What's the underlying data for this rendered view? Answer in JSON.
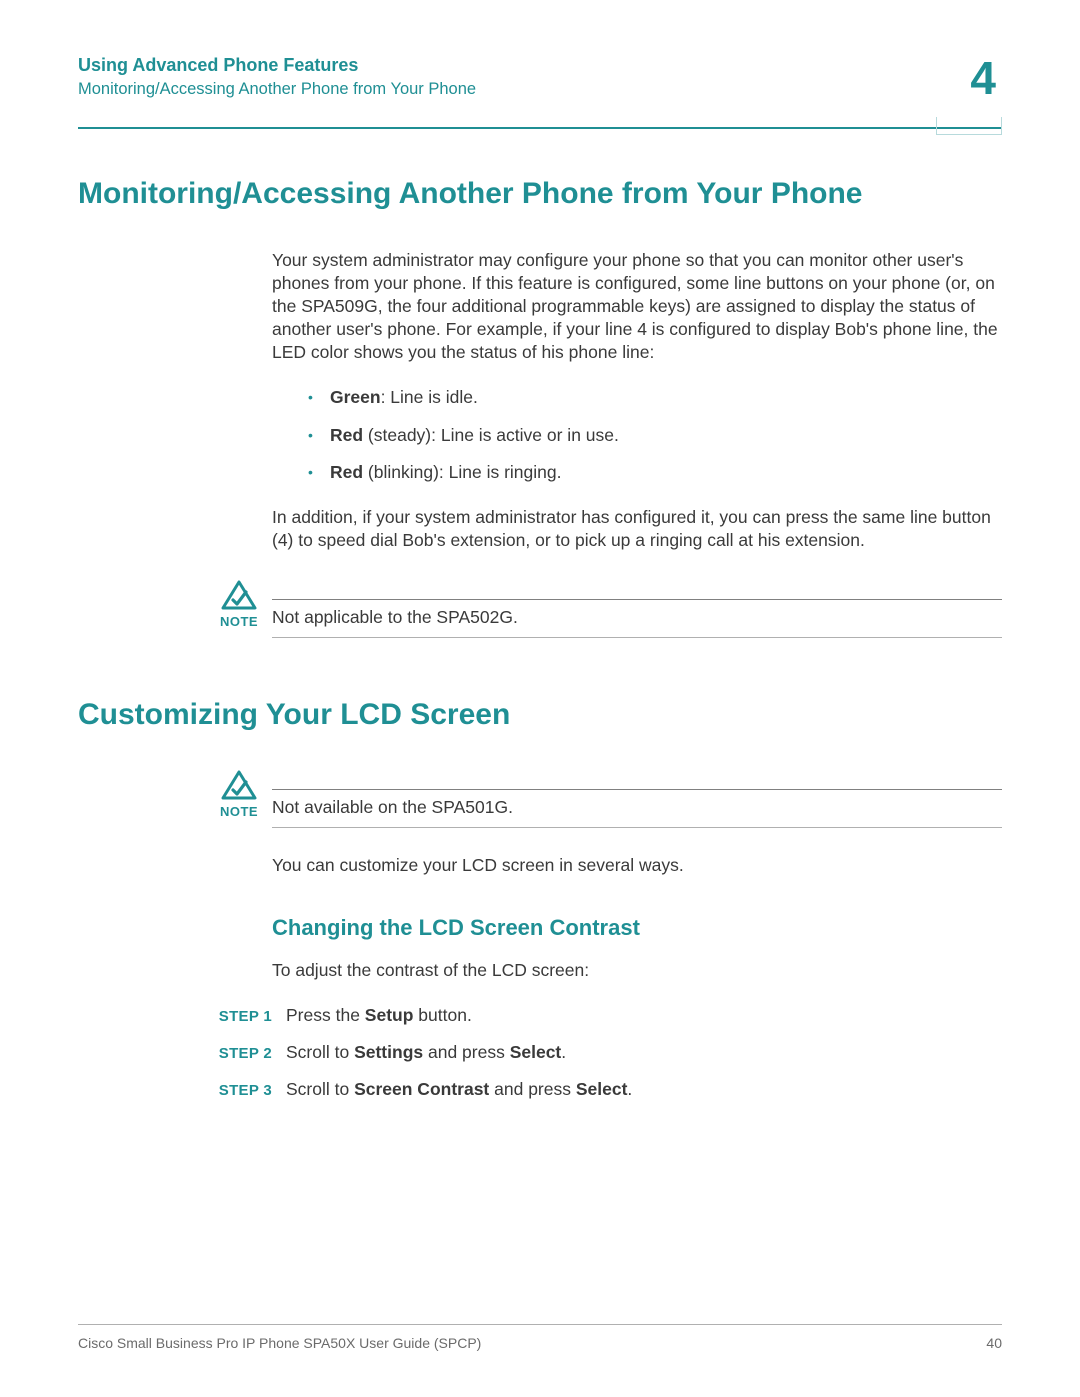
{
  "header": {
    "chapter_title": "Using Advanced Phone Features",
    "section_title": "Monitoring/Accessing Another Phone from Your Phone",
    "chapter_number": "4"
  },
  "section1": {
    "heading": "Monitoring/Accessing Another Phone from Your Phone",
    "intro": "Your system administrator may configure your phone so that you can monitor other user's phones from your phone. If this feature is configured, some line buttons on your phone (or, on the SPA509G, the four additional programmable keys) are assigned to display the status of another user's phone. For example, if your line 4 is configured to display Bob's phone line, the LED color shows you the status of his phone line:",
    "bullets": [
      {
        "bold": "Green",
        "rest": ": Line is idle."
      },
      {
        "bold": "Red",
        "rest": " (steady): Line is active or in use."
      },
      {
        "bold": "Red",
        "rest": " (blinking): Line is ringing."
      }
    ],
    "para2": "In addition, if your system administrator has configured it, you can press the same line button (4) to speed dial Bob's extension, or to pick up a ringing call at his extension.",
    "note_label": "NOTE",
    "note_text": "Not applicable to the SPA502G."
  },
  "section2": {
    "heading": "Customizing Your LCD Screen",
    "note_label": "NOTE",
    "note_text": "Not available on the SPA501G.",
    "para": "You can customize your LCD screen in several ways.",
    "subheading": "Changing the LCD Screen Contrast",
    "subpara": "To adjust the contrast of the LCD screen:",
    "steps": [
      {
        "label": "STEP 1",
        "pre": "Press the ",
        "b1": "Setup",
        "post": " button."
      },
      {
        "label": "STEP 2",
        "pre": "Scroll to ",
        "b1": "Settings",
        "post": " and press ",
        "b2": "Select",
        "tail": "."
      },
      {
        "label": "STEP 3",
        "pre": "Scroll to ",
        "b1": "Screen Contrast",
        "post": " and press ",
        "b2": "Select",
        "tail": "."
      }
    ]
  },
  "footer": {
    "doc_title": "Cisco Small Business Pro IP Phone SPA50X User Guide (SPCP)",
    "page_number": "40"
  }
}
